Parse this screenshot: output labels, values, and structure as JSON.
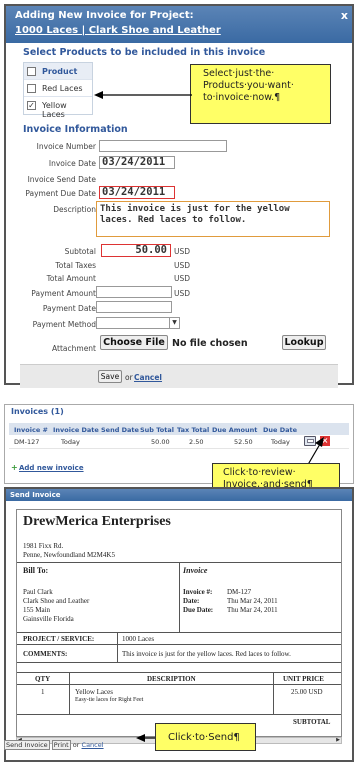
{
  "dialog": {
    "title_line1": "Adding New Invoice for Project:",
    "title_line2": "1000 Laces | Clark Shoe and Leather",
    "close_symbol": "x",
    "products_heading": "Select Products to be included in this invoice",
    "product_header": "Product",
    "products": [
      {
        "label": "Red Laces",
        "checked": ""
      },
      {
        "label": "Yellow Laces",
        "checked": "✓"
      }
    ],
    "callout1": "Select·just·the· Products·you·want· to·invoice·now.¶",
    "invoice_heading": "Invoice Information",
    "fields": {
      "invoice_number_label": "Invoice Number",
      "invoice_number_value": "",
      "invoice_date_label": "Invoice Date",
      "invoice_date_value": "03/24/2011",
      "invoice_send_date_label": "Invoice Send Date",
      "payment_due_date_label": "Payment Due Date",
      "payment_due_date_value": "03/24/2011",
      "description_label": "Description",
      "description_value": "This invoice is just for the yellow laces. Red laces to follow.",
      "subtotal_label": "Subtotal",
      "subtotal_value": "50.00",
      "currency": "USD",
      "total_taxes_label": "Total Taxes",
      "total_amount_label": "Total Amount",
      "payment_amount_label": "Payment Amount",
      "payment_date_label": "Payment Date",
      "payment_method_label": "Payment Method",
      "attachment_label": "Attachment",
      "choose_file_label": "Choose File",
      "no_file_text": "No file chosen",
      "lookup_label": "Lookup"
    },
    "save_label": "Save",
    "or_text": "or",
    "cancel_label": "Cancel"
  },
  "invoices": {
    "title": "Invoices (1)",
    "columns": [
      "Invoice #",
      "Invoice Date",
      "Send Date",
      "Sub Total",
      "Tax Total",
      "Due Amount",
      "Due Date"
    ],
    "rows": [
      [
        "DM-127",
        "Today",
        "",
        "50.00",
        "2.50",
        "52.50",
        "Today"
      ]
    ],
    "add_new_label": "Add new invoice",
    "callout2": "Click·to·review· Invoice,·and·send¶"
  },
  "send": {
    "title": "Send Invoice",
    "company": "DrewMerica Enterprises",
    "address1": "1981 Fixx Rd.",
    "address2": "Penne, Newfoundland M2M4K5",
    "bill_to_label": "Bill To:",
    "invoice_label": "Invoice",
    "bill_to": [
      "Paul Clark",
      "Clark Shoe and Leather",
      "155 Main",
      "Gainsville Florida"
    ],
    "inv_num_label": "Invoice #:",
    "inv_num_value": "DM-127",
    "date_label": "Date:",
    "date_value": "Thu Mar 24, 2011",
    "due_label": "Due Date:",
    "due_value": "Thu Mar 24, 2011",
    "project_label": "PROJECT / SERVICE:",
    "project_value": "1000 Laces",
    "comments_label": "COMMENTS:",
    "comments_value": "This invoice is just for the yellow laces. Red laces to follow.",
    "col_qty": "QTY",
    "col_desc": "DESCRIPTION",
    "col_price": "UNIT PRICE",
    "item_qty": "1",
    "item_name": "Yellow Laces",
    "item_sub": "Easy-tie laces for Right Feet",
    "item_price": "25.00 USD",
    "subtotal_label": "SUBTOTAL",
    "send_btn": "Send Invoice",
    "print_btn": "Print",
    "or_text": "or",
    "cancel_label": "Cancel",
    "callout3": "Click·to·Send¶"
  }
}
